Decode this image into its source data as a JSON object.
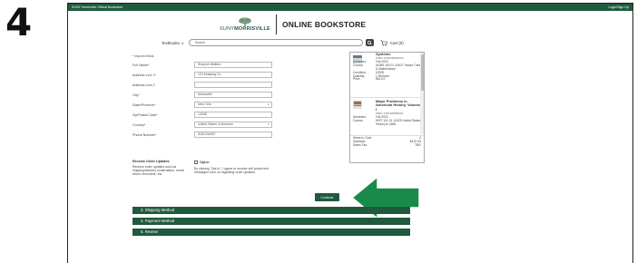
{
  "step_number": "4",
  "topbar": {
    "left_text": "SUNY Morrisville Official Bookstore",
    "right_text": "Login/Sign Up"
  },
  "header": {
    "logo_small": "est. 1908",
    "logo_suny": "SUNY",
    "logo_name": "MORRISVILLE",
    "store_title": "ONLINE BOOKSTORE",
    "nav_textbooks": "Textbooks",
    "search_placeholder": "Search",
    "cart_label": "Cart (0)"
  },
  "form": {
    "required_note": "* required fields",
    "fields": [
      {
        "label": "Full Name*",
        "value": "Shalyne Walters",
        "dropdown": false
      },
      {
        "label": "Address Line 1*",
        "value": "123 Mustang Dr.",
        "dropdown": false
      },
      {
        "label": "Address Line 2",
        "value": "",
        "dropdown": false
      },
      {
        "label": "City*",
        "value": "Morrisville",
        "dropdown": false
      },
      {
        "label": "State/Province*",
        "value": "New York",
        "dropdown": true
      },
      {
        "label": "Zip/Postal Code*",
        "value": "13408",
        "dropdown": false
      },
      {
        "label": "Country*",
        "value": "United States of America",
        "dropdown": true
      },
      {
        "label": "Phone Number*",
        "value": "5181234567",
        "dropdown": false
      }
    ]
  },
  "optin": {
    "title": "Receive Order Updates",
    "description": "Receive order updates such as shipping/delivery confirmation, rental return reminders, etc.",
    "checkbox_label": "Opt-in",
    "checked": false,
    "consent_text": "By clicking \"Opt-in\", I agree to receive cell phone text messages from us regarding order updates."
  },
  "continue_label": "Continue",
  "steps": [
    {
      "label": "3. Shipping Method"
    },
    {
      "label": "4. Payment Method"
    },
    {
      "label": "5. Review"
    }
  ],
  "sidebar": {
    "books": [
      {
        "title": "Systems",
        "isbn": "ISBN: 9781449690229",
        "semester_key": "Semester:",
        "semester": "Fall 2020",
        "course_key": "Course:",
        "course": "AGBS 100 01 10407 Tractor Care & Maintenance",
        "condition_key": "Condition:",
        "condition": "USED",
        "quantity_key": "Quantity:",
        "quantity": "1 Remove",
        "price_key": "Price:",
        "price": "$61.04"
      },
      {
        "title": "Major Problems in American History, Volume I",
        "isbn": "ISBN: 9781305585294",
        "semester_key": "Semester:",
        "semester": "Fall 2020",
        "course_key": "Course:",
        "course": "HIST 101 01 10429 United States History to 1865"
      }
    ],
    "totals": [
      {
        "label": "Items in Cart:",
        "value": "2"
      },
      {
        "label": "Subtotal:",
        "value": "$119.93"
      },
      {
        "label": "Sales Tax:",
        "value": "TBD"
      }
    ]
  },
  "colors": {
    "brand_green": "#1f5a3c",
    "arrow_green": "#1a8a4a"
  }
}
